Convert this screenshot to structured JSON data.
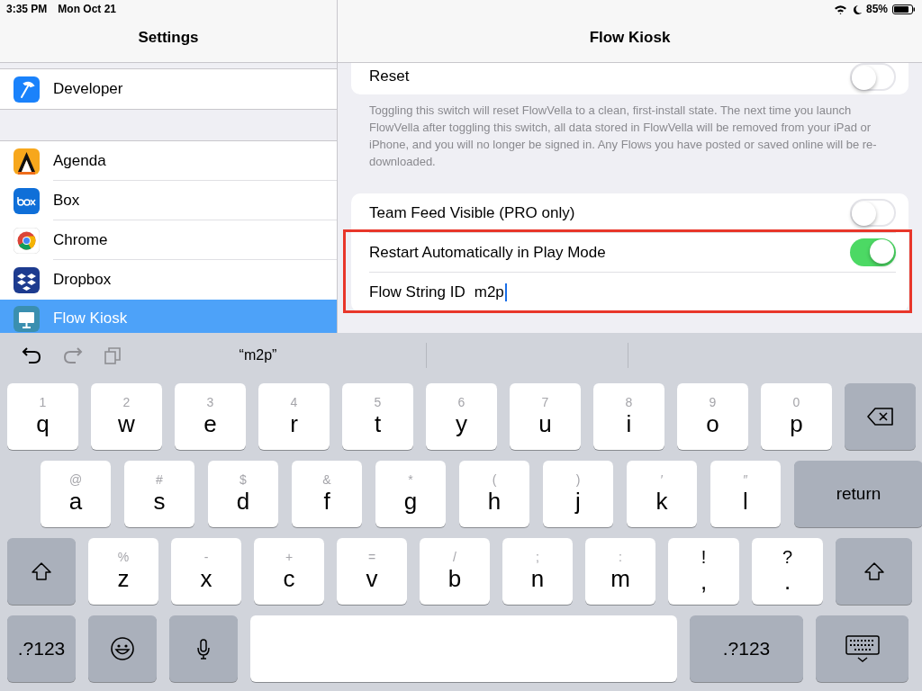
{
  "status_bar": {
    "time": "3:35 PM",
    "date": "Mon Oct 21",
    "battery": "85%"
  },
  "sidebar": {
    "title": "Settings",
    "groups": [
      [
        {
          "label": "Developer",
          "selected": false
        }
      ],
      [
        {
          "label": "Agenda",
          "selected": false
        },
        {
          "label": "Box",
          "selected": false
        },
        {
          "label": "Chrome",
          "selected": false
        },
        {
          "label": "Dropbox",
          "selected": false
        },
        {
          "label": "Flow Kiosk",
          "selected": true
        }
      ]
    ]
  },
  "detail": {
    "title": "Flow Kiosk",
    "reset": {
      "label": "Reset",
      "on": false
    },
    "reset_footer": "Toggling this switch will reset FlowVella to a clean, first-install state. The next time you launch FlowVella after toggling this switch, all data stored in FlowVella will be removed from your iPad or iPhone, and you will no longer be signed in. Any Flows you have posted or saved online will be re-downloaded.",
    "rows": [
      {
        "kind": "toggle",
        "label": "Team Feed Visible (PRO only)",
        "on": false,
        "highlighted": false
      },
      {
        "kind": "toggle",
        "label": "Restart Automatically in Play Mode",
        "on": true,
        "highlighted": true
      },
      {
        "kind": "text_field",
        "label": "Flow String ID",
        "value": "m2p",
        "focused": true,
        "highlighted": true
      }
    ]
  },
  "keyboard": {
    "suggestions": [
      "“m2p”"
    ],
    "rows": [
      [
        {
          "kind": "letter",
          "label": "q",
          "hint": "1"
        },
        {
          "kind": "letter",
          "label": "w",
          "hint": "2"
        },
        {
          "kind": "letter",
          "label": "e",
          "hint": "3"
        },
        {
          "kind": "letter",
          "label": "r",
          "hint": "4"
        },
        {
          "kind": "letter",
          "label": "t",
          "hint": "5"
        },
        {
          "kind": "letter",
          "label": "y",
          "hint": "6"
        },
        {
          "kind": "letter",
          "label": "u",
          "hint": "7"
        },
        {
          "kind": "letter",
          "label": "i",
          "hint": "8"
        },
        {
          "kind": "letter",
          "label": "o",
          "hint": "9"
        },
        {
          "kind": "letter",
          "label": "p",
          "hint": "0"
        },
        {
          "kind": "delete"
        }
      ],
      [
        {
          "kind": "letter",
          "label": "a",
          "hint": "@"
        },
        {
          "kind": "letter",
          "label": "s",
          "hint": "#"
        },
        {
          "kind": "letter",
          "label": "d",
          "hint": "$"
        },
        {
          "kind": "letter",
          "label": "f",
          "hint": "&"
        },
        {
          "kind": "letter",
          "label": "g",
          "hint": "*"
        },
        {
          "kind": "letter",
          "label": "h",
          "hint": "("
        },
        {
          "kind": "letter",
          "label": "j",
          "hint": ")"
        },
        {
          "kind": "letter",
          "label": "k",
          "hint": "′"
        },
        {
          "kind": "letter",
          "label": "l",
          "hint": "″"
        },
        {
          "kind": "return",
          "label": "return"
        }
      ],
      [
        {
          "kind": "shift"
        },
        {
          "kind": "letter",
          "label": "z",
          "hint": "%"
        },
        {
          "kind": "letter",
          "label": "x",
          "hint": "-"
        },
        {
          "kind": "letter",
          "label": "c",
          "hint": "+"
        },
        {
          "kind": "letter",
          "label": "v",
          "hint": "="
        },
        {
          "kind": "letter",
          "label": "b",
          "hint": "/"
        },
        {
          "kind": "letter",
          "label": "n",
          "hint": ";"
        },
        {
          "kind": "letter",
          "label": "m",
          "hint": ":"
        },
        {
          "kind": "punct",
          "label": ",",
          "hint": "!"
        },
        {
          "kind": "punct",
          "label": ".",
          "hint": "?"
        },
        {
          "kind": "shift"
        }
      ],
      [
        {
          "kind": "mode",
          "label": ".?123"
        },
        {
          "kind": "emoji"
        },
        {
          "kind": "mic"
        },
        {
          "kind": "space"
        },
        {
          "kind": "mode",
          "label": ".?123"
        },
        {
          "kind": "dismiss"
        }
      ]
    ]
  }
}
